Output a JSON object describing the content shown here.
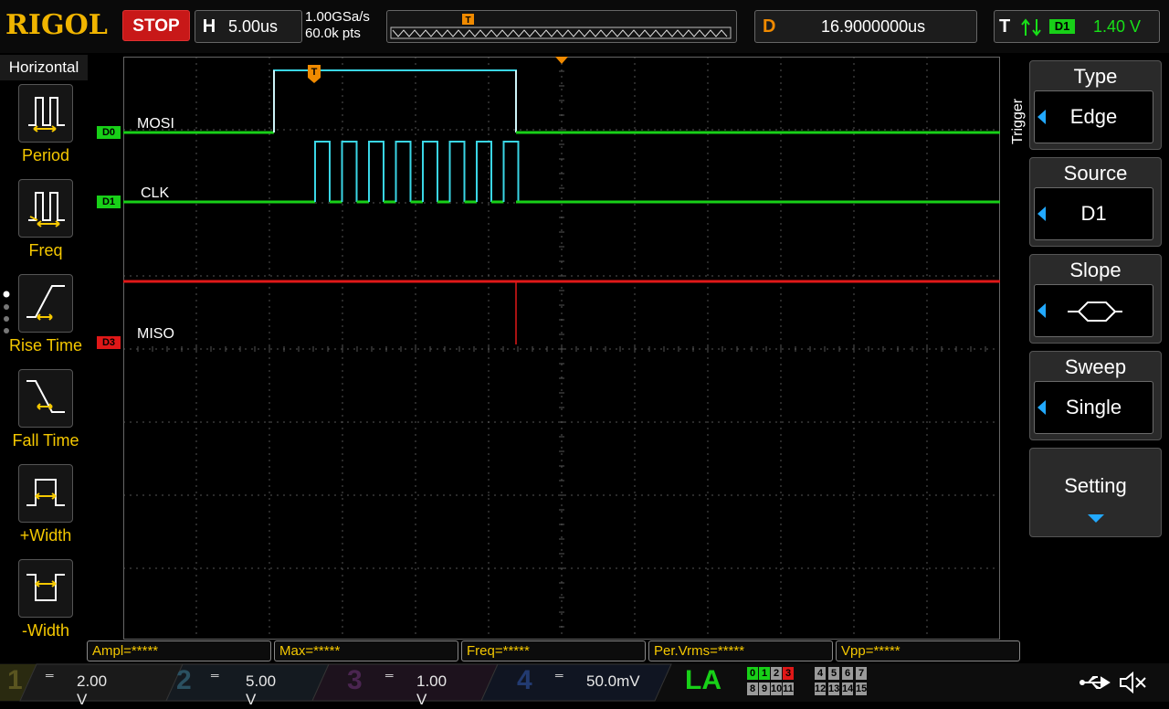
{
  "header": {
    "brand": "RIGOL",
    "run_state": "STOP",
    "horizontal": {
      "letter": "H",
      "timebase": "5.00us"
    },
    "sample_rate": "1.00GSa/s",
    "memory_depth": "60.0k pts",
    "delay": {
      "letter": "D",
      "value": "16.9000000us"
    },
    "trigger": {
      "letter": "T",
      "source": "D1",
      "level": "1.40 V"
    }
  },
  "left_menu": {
    "title": "Horizontal",
    "items": [
      {
        "label": "Period",
        "icon": "period-icon"
      },
      {
        "label": "Freq",
        "icon": "frequency-icon"
      },
      {
        "label": "Rise Time",
        "icon": "rise-time-icon"
      },
      {
        "label": "Fall Time",
        "icon": "fall-time-icon"
      },
      {
        "label": "+Width",
        "icon": "positive-width-icon"
      },
      {
        "label": "-Width",
        "icon": "negative-width-icon"
      }
    ]
  },
  "right_menu": {
    "tab": "Trigger",
    "items": [
      {
        "title": "Type",
        "value": "Edge"
      },
      {
        "title": "Source",
        "value": "D1"
      },
      {
        "title": "Slope",
        "value": ""
      },
      {
        "title": "Sweep",
        "value": "Single"
      },
      {
        "title": "Setting",
        "value": ""
      }
    ]
  },
  "channels_digital": [
    {
      "tag": "D0",
      "name": "MOSI",
      "color": "#18d018"
    },
    {
      "tag": "D1",
      "name": "CLK",
      "color": "#18d018"
    },
    {
      "tag": "D3",
      "name": "MISO",
      "color": "#e01818"
    }
  ],
  "trace_colors": {
    "digital_high": "#3ad6e6",
    "digital_low": "#18d018",
    "miso": "#e01818",
    "trigger_marker": "#f08a00"
  },
  "measurements": [
    "Ampl=*****",
    "Max=*****",
    "Freq=*****",
    "Per.Vrms=*****",
    "Vpp=*****"
  ],
  "analog_channels": [
    {
      "num": "1",
      "scale": "2.00 V",
      "color": "#c8b400"
    },
    {
      "num": "2",
      "scale": "5.00 V",
      "color": "#22a9ff"
    },
    {
      "num": "3",
      "scale": "1.00 V",
      "color": "#c020c0"
    },
    {
      "num": "4",
      "scale": "50.0mV",
      "color": "#2a70e0"
    }
  ],
  "la": {
    "label": "LA",
    "group1_row1": [
      "0",
      "1",
      "2",
      "3"
    ],
    "group1_row2": [
      "8",
      "9",
      "10",
      "11"
    ],
    "group2_row1": [
      "4",
      "5",
      "6",
      "7"
    ],
    "group2_row2": [
      "12",
      "13",
      "14",
      "15"
    ]
  }
}
